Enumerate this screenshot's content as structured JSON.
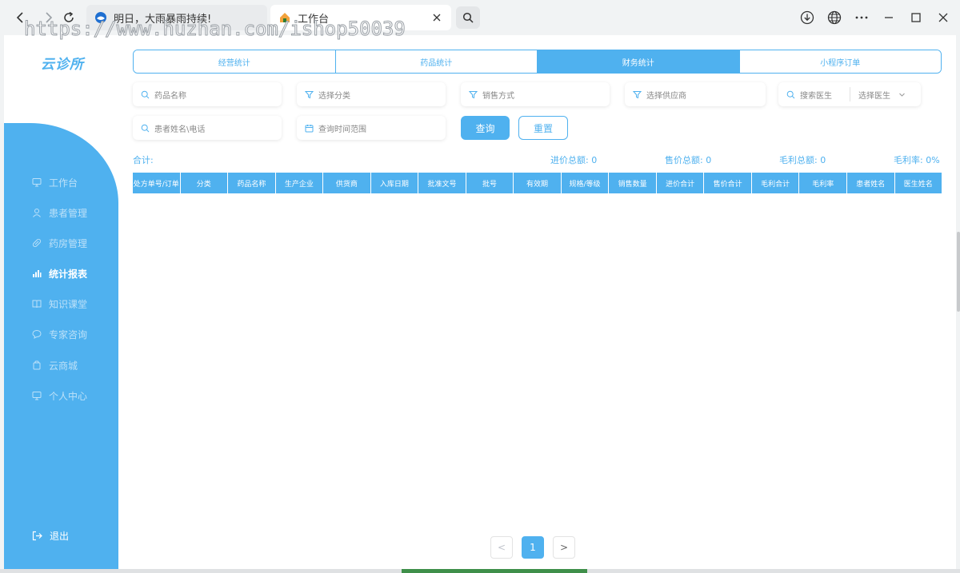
{
  "browser": {
    "tabs": [
      {
        "title": "明日，大雨暴雨持续!"
      },
      {
        "title": "工作台"
      }
    ],
    "watermark": "https://www.huzhan.com/ishop50039"
  },
  "app": {
    "logo": "云诊所",
    "sidebar": {
      "items": [
        {
          "label": "工作台",
          "icon": "monitor-icon"
        },
        {
          "label": "患者管理",
          "icon": "user-icon"
        },
        {
          "label": "药房管理",
          "icon": "pill-icon"
        },
        {
          "label": "统计报表",
          "icon": "bar-chart-icon",
          "active": true
        },
        {
          "label": "知识课堂",
          "icon": "book-icon"
        },
        {
          "label": "专家咨询",
          "icon": "chat-icon"
        },
        {
          "label": "云商城",
          "icon": "shop-bag-icon"
        },
        {
          "label": "个人中心",
          "icon": "monitor-icon"
        }
      ],
      "logout": "退出"
    },
    "topnav": [
      {
        "label": "经营统计"
      },
      {
        "label": "药品统计"
      },
      {
        "label": "财务统计",
        "active": true
      },
      {
        "label": "小程序订单"
      }
    ],
    "filters": {
      "drug_name": "药品名称",
      "category": "选择分类",
      "sale_method": "销售方式",
      "supplier": "选择供应商",
      "search_doctor": "搜索医生",
      "select_doctor": "选择医生",
      "patient": "患者姓名\\电话",
      "date_range": "查询时间范围",
      "query_button": "查询",
      "reset_button": "重置"
    },
    "summary": {
      "total_label": "合计:",
      "purchase_total": "进价总额:  0",
      "sale_total": "售价总额:  0",
      "gross_total": "毛利总额:  0",
      "gross_rate": "毛利率:  0%"
    },
    "table": {
      "columns": [
        "处方单号/订单",
        "分类",
        "药品名称",
        "生产企业",
        "供货商",
        "入库日期",
        "批准文号",
        "批号",
        "有效期",
        "规格/等级",
        "销售数量",
        "进价合计",
        "售价合计",
        "毛利合计",
        "毛利率",
        "患者姓名",
        "医生姓名"
      ]
    },
    "pagination": {
      "prev": "<",
      "current": "1",
      "next": ">"
    },
    "colors": {
      "accent": "#4fb1ef",
      "sidebar": "#4fb1ef"
    }
  }
}
